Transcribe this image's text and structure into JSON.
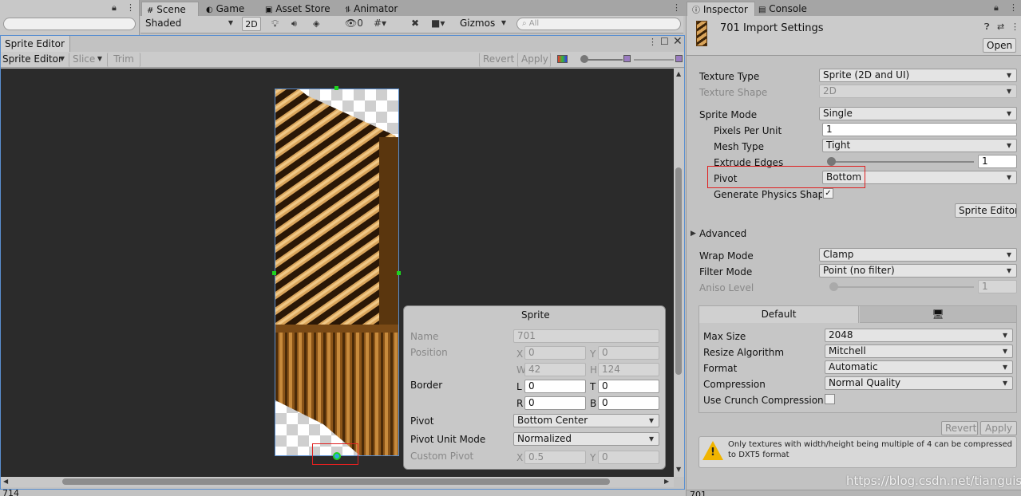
{
  "top_tabs": {
    "scene": "Scene",
    "game": "Game",
    "asset_store": "Asset Store",
    "animator": "Animator",
    "inspector": "Inspector",
    "console": "Console"
  },
  "scene_toolbar": {
    "shading": "Shaded",
    "mode_2d": "2D",
    "hidden_count": "0",
    "gizmos": "Gizmos",
    "search_placeholder": "All"
  },
  "sprite_editor": {
    "window_title": "Sprite Editor",
    "mode_dropdown": "Sprite Editor",
    "slice": "Slice",
    "trim": "Trim",
    "revert": "Revert",
    "apply": "Apply"
  },
  "sprite_panel": {
    "title": "Sprite",
    "name_label": "Name",
    "name_value": "701",
    "position_label": "Position",
    "x_label": "X",
    "x_value": "0",
    "y_label": "Y",
    "y_value": "0",
    "w_label": "W",
    "w_value": "42",
    "h_label": "H",
    "h_value": "124",
    "border_label": "Border",
    "l_label": "L",
    "l_value": "0",
    "t_label": "T",
    "t_value": "0",
    "r_label": "R",
    "r_value": "0",
    "b_label": "B",
    "b_value": "0",
    "pivot_label": "Pivot",
    "pivot_value": "Bottom Center",
    "pivot_unit_label": "Pivot Unit Mode",
    "pivot_unit_value": "Normalized",
    "custom_pivot_label": "Custom Pivot",
    "cx_value": "0.5",
    "cy_value": "0"
  },
  "inspector": {
    "asset_title": "701 Import Settings",
    "open": "Open",
    "texture_type_label": "Texture Type",
    "texture_type_value": "Sprite (2D and UI)",
    "texture_shape_label": "Texture Shape",
    "texture_shape_value": "2D",
    "sprite_mode_label": "Sprite Mode",
    "sprite_mode_value": "Single",
    "ppu_label": "Pixels Per Unit",
    "ppu_value": "1",
    "mesh_type_label": "Mesh Type",
    "mesh_type_value": "Tight",
    "extrude_label": "Extrude Edges",
    "extrude_value": "1",
    "pivot_label": "Pivot",
    "pivot_value": "Bottom",
    "physics_label": "Generate Physics Shape",
    "sprite_editor_button": "Sprite Editor",
    "advanced": "Advanced",
    "wrap_label": "Wrap Mode",
    "wrap_value": "Clamp",
    "filter_label": "Filter Mode",
    "filter_value": "Point (no filter)",
    "aniso_label": "Aniso Level",
    "aniso_value": "1",
    "platform_default": "Default",
    "max_size_label": "Max Size",
    "max_size_value": "2048",
    "resize_label": "Resize Algorithm",
    "resize_value": "Mitchell",
    "format_label": "Format",
    "format_value": "Automatic",
    "compression_label": "Compression",
    "compression_value": "Normal Quality",
    "crunch_label": "Use Crunch Compression",
    "revert": "Revert",
    "apply": "Apply",
    "warning": "Only textures with width/height being multiple of 4 can be compressed to DXT5 format",
    "footer_left": "701"
  },
  "bottom": {
    "left_counter": "714"
  },
  "watermark": "https://blog.csdn.net/tianguisu",
  "colors": {
    "highlight_box": "#e02020",
    "selected_tab": "#cbcbcb",
    "canvas_bg": "#2b2b2b"
  }
}
